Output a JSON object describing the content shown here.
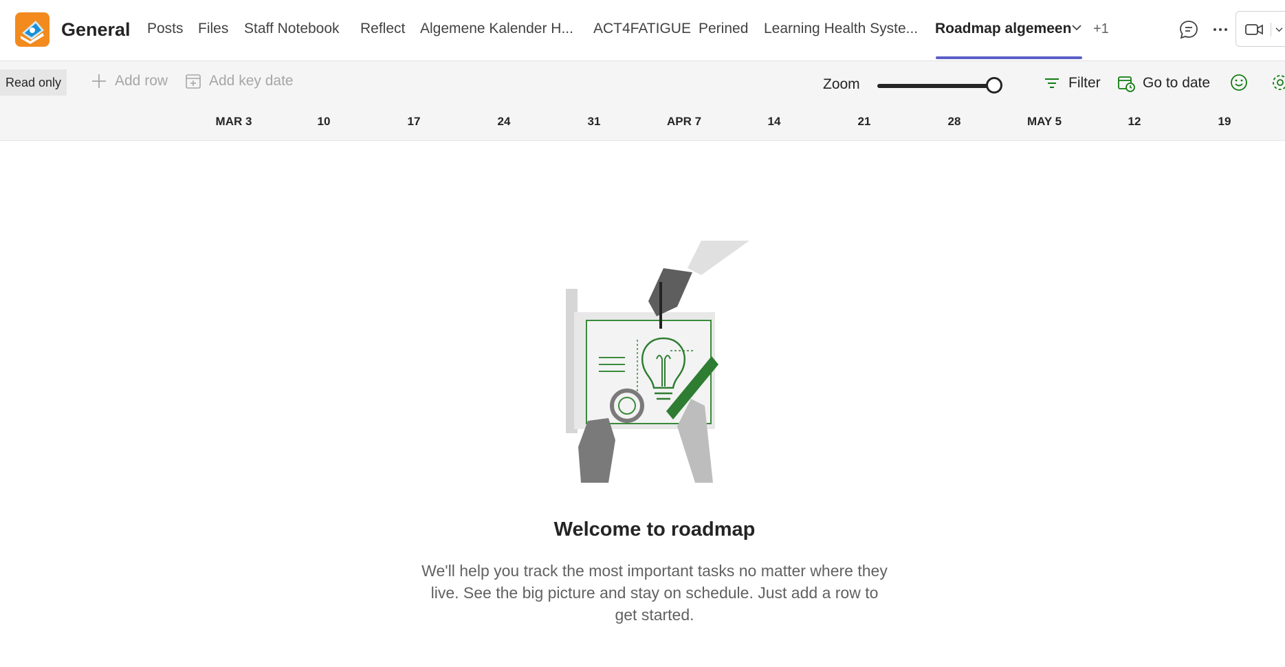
{
  "header": {
    "channel_name": "General",
    "tabs": [
      {
        "label": "Posts"
      },
      {
        "label": "Files"
      },
      {
        "label": "Staff Notebook"
      },
      {
        "label": "Reflect"
      },
      {
        "label": "Algemene Kalender H..."
      },
      {
        "label": "ACT4FATIGUE"
      },
      {
        "label": "Perined"
      },
      {
        "label": "Learning Health Syste..."
      },
      {
        "label": "Roadmap algemeen",
        "active": true
      }
    ],
    "more_tabs": "+1",
    "icons": [
      "app-logo-icon",
      "chevron-down-icon",
      "chat-icon",
      "more-icon",
      "video-icon"
    ],
    "accent_color": "#5b5fc7"
  },
  "toolbar": {
    "read_only": "Read only",
    "add_row": "Add row",
    "add_key_date": "Add key date",
    "zoom_label": "Zoom",
    "zoom_level": 1.0,
    "filter": "Filter",
    "go_to_date": "Go to date",
    "icons": [
      "plus-icon",
      "calendar-add-icon",
      "filter-icon",
      "calendar-clock-icon",
      "smiley-icon",
      "settings-icon"
    ],
    "action_color": "#107c10"
  },
  "timeline": {
    "dates": [
      "MAR 3",
      "10",
      "17",
      "24",
      "31",
      "APR 7",
      "14",
      "21",
      "28",
      "MAY 5",
      "12",
      "19"
    ]
  },
  "empty_state": {
    "title": "Welcome to roadmap",
    "body": "We'll help you track the most important tasks no matter where they live. See the big picture and stay on schedule. Just add a row to get started.",
    "illustration": "roadmap-planning-illustration"
  }
}
